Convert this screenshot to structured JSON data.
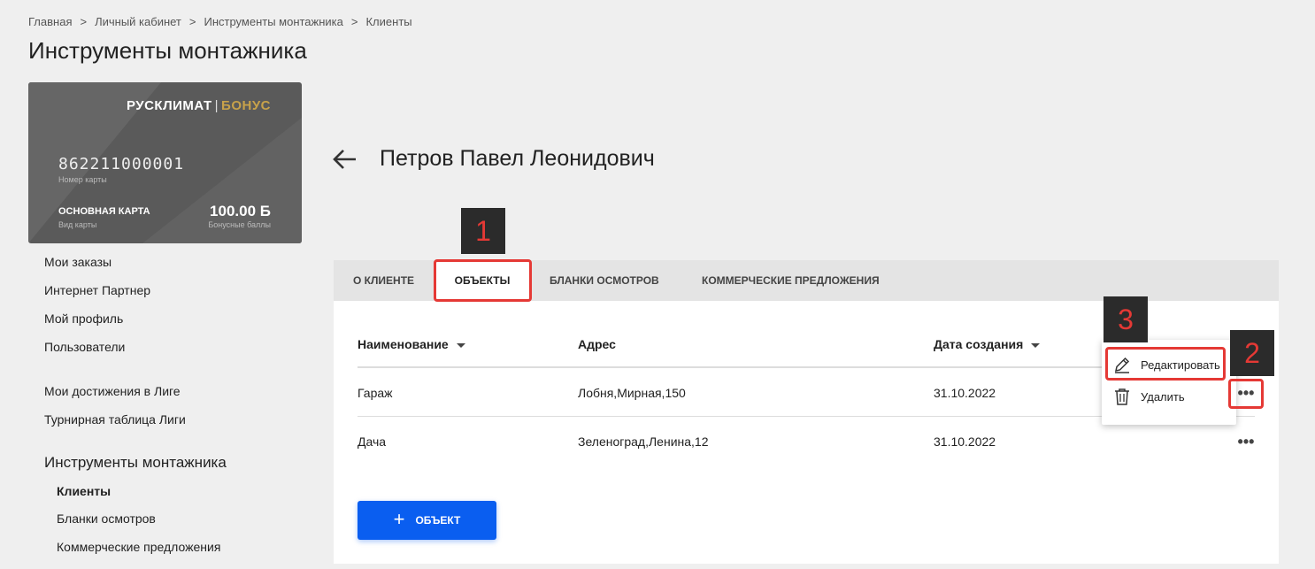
{
  "breadcrumb": [
    {
      "label": "Главная"
    },
    {
      "label": "Личный кабинет"
    },
    {
      "label": "Инструменты монтажника"
    },
    {
      "label": "Клиенты"
    }
  ],
  "breadcrumb_separator": ">",
  "page_title": "Инструменты монтажника",
  "card": {
    "logo_main": "РУСКЛИМАТ",
    "logo_sep": "|",
    "logo_bonus": "БОНУС",
    "number": "862211000001",
    "number_caption": "Номер карты",
    "type": "ОСНОВНАЯ КАРТА",
    "type_caption": "Вид карты",
    "points": "100.00 Б",
    "points_caption": "Бонусные баллы"
  },
  "sidebar": {
    "links": [
      {
        "label": "Мои заказы"
      },
      {
        "label": "Интернет Партнер"
      },
      {
        "label": "Мой профиль"
      },
      {
        "label": "Пользователи"
      },
      {
        "label": "Мои достижения в Лиге"
      },
      {
        "label": "Турнирная таблица Лиги"
      }
    ],
    "section_heading": "Инструменты монтажника",
    "section_items": [
      {
        "label": "Клиенты",
        "active": true
      },
      {
        "label": "Бланки осмотров"
      },
      {
        "label": "Коммерческие предложения"
      }
    ]
  },
  "client": {
    "name": "Петров Павел Леонидович"
  },
  "tabs": [
    {
      "label": "О клиенте"
    },
    {
      "label": "Объекты",
      "active": true
    },
    {
      "label": "Бланки осмотров"
    },
    {
      "label": "Коммерческие предложения"
    }
  ],
  "table": {
    "columns": [
      {
        "label": "Наименование",
        "sortable": true
      },
      {
        "label": "Адрес"
      },
      {
        "label": "Дата создания",
        "sortable": true
      }
    ],
    "rows": [
      {
        "name": "Гараж",
        "address": "Лобня,Мирная,150",
        "date": "31.10.2022"
      },
      {
        "name": "Дача",
        "address": "Зеленоград,Ленина,12",
        "date": "31.10.2022"
      }
    ]
  },
  "add_button": {
    "icon": "plus-icon",
    "label": "ОБЪЕКТ"
  },
  "menu": {
    "edit_label": "Редактировать",
    "edit_icon": "pencil-icon",
    "delete_label": "Удалить",
    "delete_icon": "trash-icon"
  },
  "annotations": [
    "1",
    "2",
    "3"
  ],
  "colors": {
    "accent": "#0a5ef0",
    "annotation": "#e53935",
    "bonus_gold": "#c8a24a",
    "card_bg": "#5a5a5a"
  }
}
